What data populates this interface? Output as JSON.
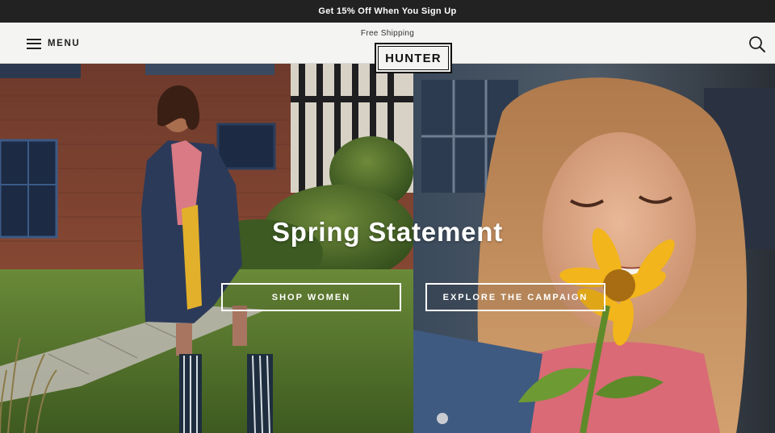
{
  "promo": {
    "text": "Get 15% Off When You Sign Up"
  },
  "header": {
    "menu_label": "MENU",
    "free_shipping": "Free Shipping",
    "logo_text": "HUNTER",
    "icons": {
      "menu": "hamburger-icon",
      "search": "search-icon"
    }
  },
  "hero": {
    "title": "Spring Statement",
    "cta_women": "SHOP WOMEN",
    "cta_campaign": "EXPLORE THE CAMPAIGN"
  },
  "colors": {
    "promo_bg": "#222222",
    "header_bg": "#f4f4f2",
    "hero_text": "#ffffff",
    "grass": "#4f6a2a",
    "brick": "#7a3a28",
    "coat": "#2c3a5a",
    "flower": "#f2b51b"
  }
}
